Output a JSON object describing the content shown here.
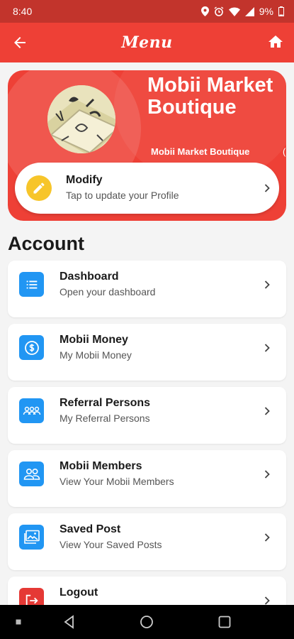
{
  "status_bar": {
    "time": "8:40",
    "battery": "9%"
  },
  "app_bar": {
    "title": "Menu"
  },
  "profile": {
    "name": "Mobii Market Boutique",
    "subtitle": "Mobii Market Boutique",
    "subtitle_overflow": "(",
    "modify": {
      "title": "Modify",
      "subtitle": "Tap to update your Profile"
    }
  },
  "account": {
    "title": "Account",
    "items": [
      {
        "title": "Dashboard",
        "subtitle": "Open your dashboard",
        "icon": "list-icon"
      },
      {
        "title": "Mobii Money",
        "subtitle": "My Mobii Money",
        "icon": "dollar-coin-icon"
      },
      {
        "title": "Referral Persons",
        "subtitle": "My Referral Persons",
        "icon": "group-icon"
      },
      {
        "title": "Mobii Members",
        "subtitle": "View Your Mobii Members",
        "icon": "members-icon"
      },
      {
        "title": "Saved Post",
        "subtitle": "View Your Saved Posts",
        "icon": "image-icon"
      },
      {
        "title": "Logout",
        "subtitle": "",
        "icon": "logout-icon"
      }
    ]
  },
  "colors": {
    "primary": "#ee4036",
    "status_bar": "#c2342c",
    "icon_blue": "#2196f3",
    "pencil_yellow": "#f7c52a"
  }
}
